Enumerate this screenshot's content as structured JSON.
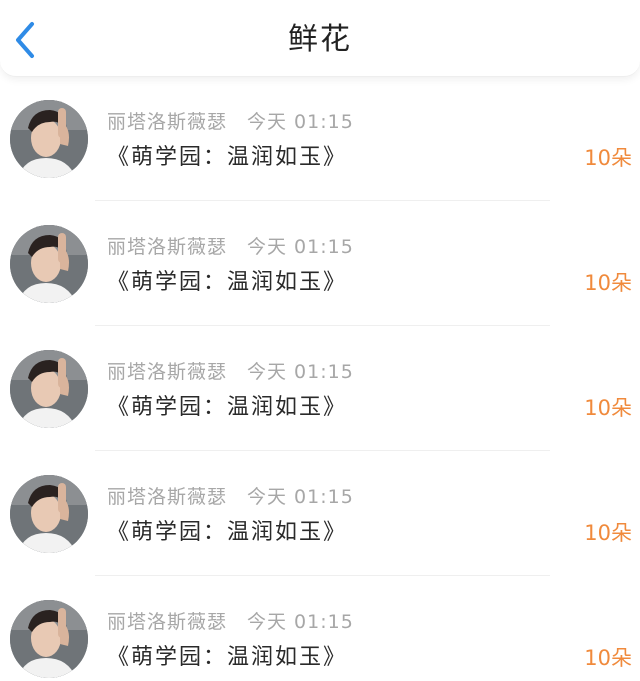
{
  "header": {
    "title": "鲜花",
    "back_icon": "chevron-left-icon",
    "accent_color": "#2f8be6"
  },
  "list": {
    "count_color": "#f08a3c",
    "items": [
      {
        "avatar": "user-avatar",
        "username": "丽塔洛斯薇瑟",
        "time": "今天 01:15",
        "message": "《萌学园：温润如玉》",
        "count": "10朵"
      },
      {
        "avatar": "user-avatar",
        "username": "丽塔洛斯薇瑟",
        "time": "今天 01:15",
        "message": "《萌学园：温润如玉》",
        "count": "10朵"
      },
      {
        "avatar": "user-avatar",
        "username": "丽塔洛斯薇瑟",
        "time": "今天 01:15",
        "message": "《萌学园：温润如玉》",
        "count": "10朵"
      },
      {
        "avatar": "user-avatar",
        "username": "丽塔洛斯薇瑟",
        "time": "今天 01:15",
        "message": "《萌学园：温润如玉》",
        "count": "10朵"
      },
      {
        "avatar": "user-avatar",
        "username": "丽塔洛斯薇瑟",
        "time": "今天 01:15",
        "message": "《萌学园：温润如玉》",
        "count": "10朵"
      }
    ]
  }
}
